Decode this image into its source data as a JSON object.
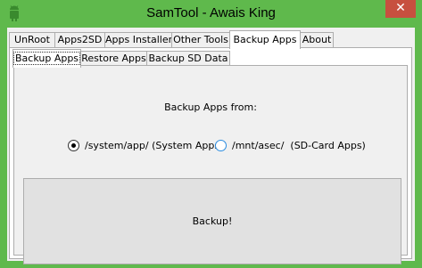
{
  "window": {
    "title": "SamTool - Awais King",
    "close_glyph": "✕",
    "frame_color": "#5FB94C",
    "close_color": "#C7503F"
  },
  "main_tabs": [
    {
      "label": "UnRoot",
      "active": false
    },
    {
      "label": "Apps2SD",
      "active": false
    },
    {
      "label": "Apps Installer",
      "active": false
    },
    {
      "label": "Other Tools",
      "active": false
    },
    {
      "label": "Backup Apps",
      "active": true
    },
    {
      "label": "About",
      "active": false
    }
  ],
  "sub_tabs": [
    {
      "label": "Backup Apps",
      "active": true
    },
    {
      "label": "Restore Apps",
      "active": false
    },
    {
      "label": "Backup SD Data",
      "active": false
    }
  ],
  "backup_panel": {
    "from_label": "Backup Apps from:",
    "options": [
      {
        "label": "/system/app/ (System Apps)",
        "selected": true
      },
      {
        "label": "/mnt/asec/  (SD-Card Apps)",
        "selected": false
      }
    ],
    "backup_button": "Backup!"
  }
}
